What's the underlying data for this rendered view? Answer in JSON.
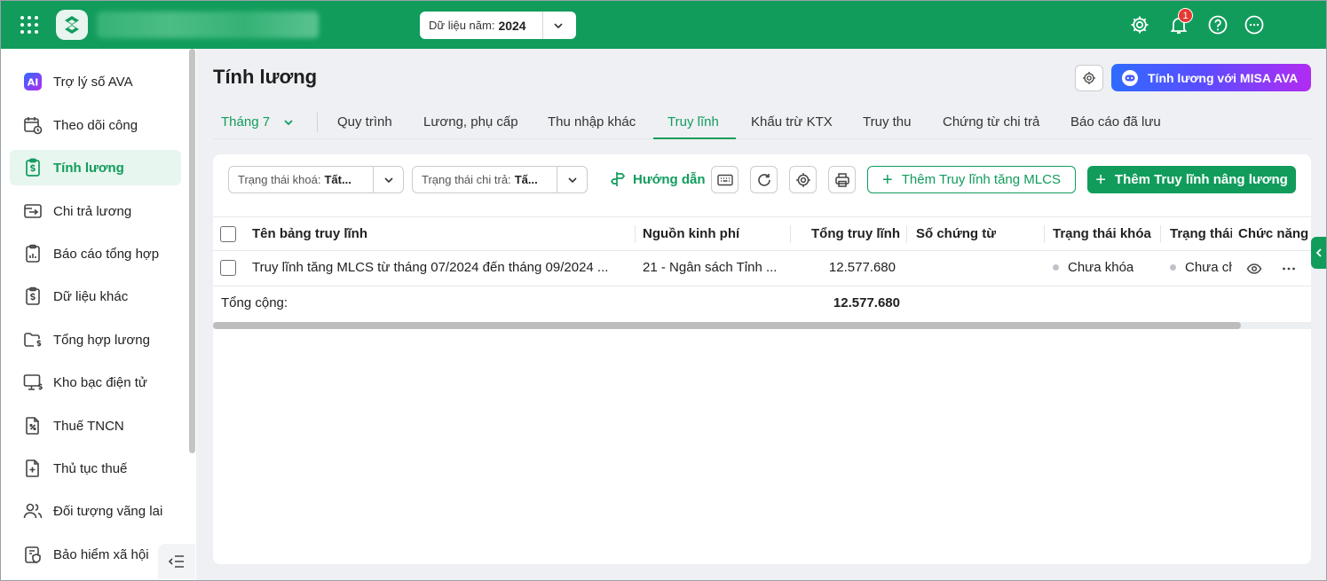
{
  "topbar": {
    "year_label": "Dữ liệu năm:",
    "year_value": "2024",
    "notification_count": "1"
  },
  "sidebar": {
    "items": [
      {
        "label": "Trợ lý số AVA",
        "icon": "ai-icon"
      },
      {
        "label": "Theo dõi công",
        "icon": "calendar-clock-icon"
      },
      {
        "label": "Tính lương",
        "icon": "salary-clipboard-icon",
        "active": true
      },
      {
        "label": "Chi trả lương",
        "icon": "payment-icon"
      },
      {
        "label": "Báo cáo tổng hợp",
        "icon": "report-icon"
      },
      {
        "label": "Dữ liệu khác",
        "icon": "data-clipboard-icon"
      },
      {
        "label": "Tổng hợp lương",
        "icon": "folder-money-icon"
      },
      {
        "label": "Kho bạc điện tử",
        "icon": "monitor-money-icon"
      },
      {
        "label": "Thuế TNCN",
        "icon": "tax-file-icon"
      },
      {
        "label": "Thủ tục thuế",
        "icon": "file-plus-icon"
      },
      {
        "label": "Đối tượng vãng lai",
        "icon": "users-icon"
      },
      {
        "label": "Bảo hiểm xã hội",
        "icon": "insurance-icon"
      }
    ]
  },
  "page": {
    "title": "Tính lương",
    "ava_button": "Tính lương với MISA AVA"
  },
  "tabs": {
    "month": "Tháng 7",
    "items": [
      "Quy trình",
      "Lương, phụ cấp",
      "Thu nhập khác",
      "Truy lĩnh",
      "Khấu trừ KTX",
      "Truy thu",
      "Chứng từ chi trả",
      "Báo cáo đã lưu"
    ],
    "active": "Truy lĩnh"
  },
  "toolbar": {
    "lock_filter_label": "Trạng thái khoá:",
    "lock_filter_value": "Tất...",
    "pay_filter_label": "Trạng thái chi trả:",
    "pay_filter_value": "Tấ...",
    "guide_label": "Hướng dẫn",
    "add_mlcs_label": "Thêm Truy lĩnh tăng MLCS",
    "add_raise_label": "Thêm Truy lĩnh nâng lương"
  },
  "table": {
    "headers": {
      "name": "Tên bảng truy lĩnh",
      "fund": "Nguồn kinh phí",
      "total": "Tổng truy lĩnh",
      "voucher": "Số chứng từ",
      "lock_status": "Trạng thái khóa",
      "pay_status": "Trạng thái",
      "actions": "Chức năng"
    },
    "rows": [
      {
        "name": "Truy lĩnh tăng MLCS từ tháng 07/2024 đến tháng 09/2024 ...",
        "fund": "21 - Ngân sách Tỉnh ...",
        "total": "12.577.680",
        "voucher": "",
        "lock_status": "Chưa khóa",
        "pay_status": "Chưa ch"
      }
    ],
    "footer": {
      "label": "Tổng cộng:",
      "total": "12.577.680"
    }
  }
}
